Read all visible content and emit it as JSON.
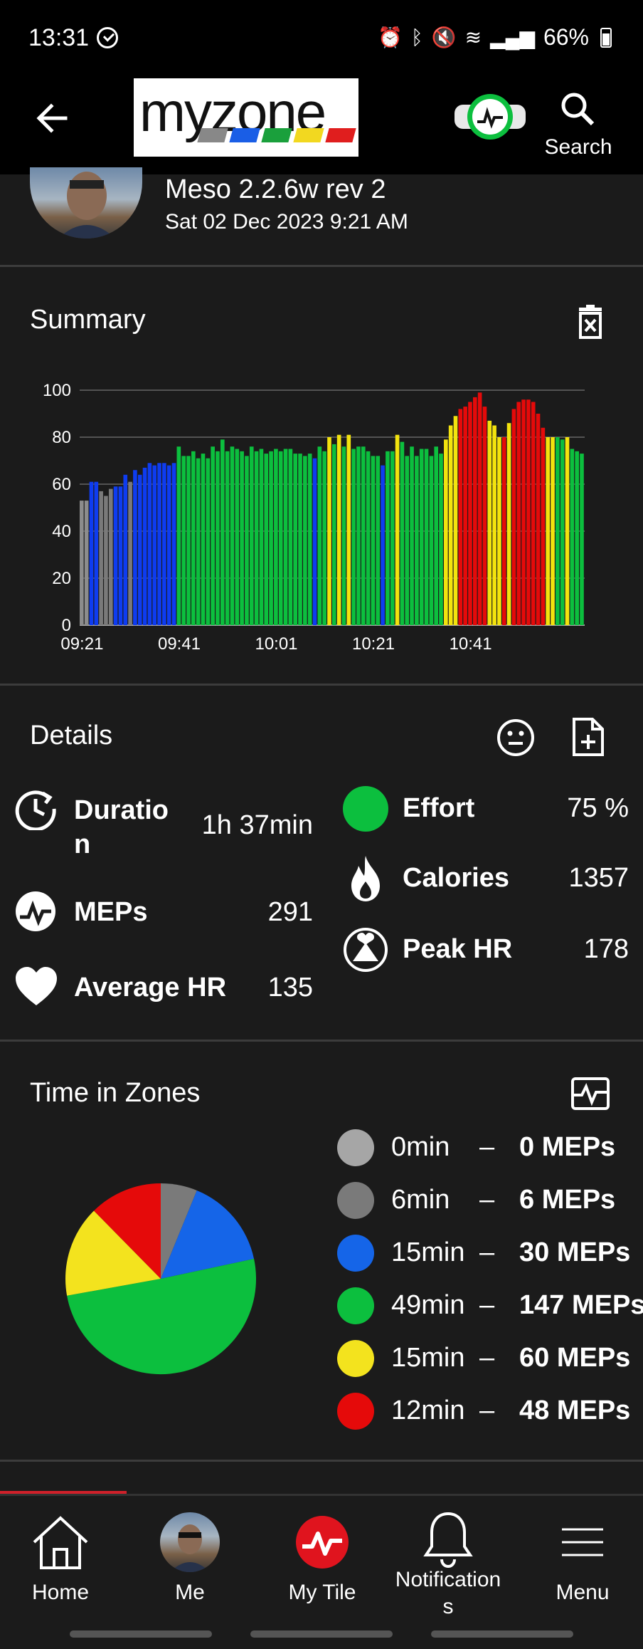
{
  "status_bar": {
    "time": "13:31",
    "battery": "66%"
  },
  "app_bar": {
    "logo_text": "myzone",
    "search_label": "Search"
  },
  "workout": {
    "title": "Meso 2.2.6w rev 2",
    "date": "Sat 02 Dec 2023 9:21 AM"
  },
  "summary": {
    "title": "Summary"
  },
  "chart_data": {
    "type": "bar",
    "title": "",
    "xlabel": "",
    "ylabel": "",
    "ylim": [
      0,
      100
    ],
    "y_ticks": [
      "0",
      "20",
      "40",
      "60",
      "80",
      "100"
    ],
    "x_ticks": [
      "09:21",
      "09:41",
      "10:01",
      "10:21",
      "10:41"
    ],
    "grid": true,
    "zone_colors": {
      "grey-light": "#8c8c8c",
      "grey": "#7a7a7a",
      "blue": "#0e3cf0",
      "green": "#0cbf3e",
      "yellow": "#f3e30e",
      "red": "#e50a0a"
    },
    "values": [
      53,
      53,
      61,
      61,
      57,
      55,
      58,
      59,
      59,
      64,
      61,
      66,
      64,
      67,
      69,
      68,
      69,
      69,
      68,
      69,
      76,
      72,
      72,
      74,
      71,
      73,
      71,
      76,
      74,
      79,
      74,
      76,
      75,
      74,
      72,
      76,
      74,
      75,
      73,
      74,
      75,
      74,
      75,
      75,
      73,
      73,
      72,
      73,
      71,
      76,
      74,
      80,
      77,
      81,
      76,
      81,
      75,
      76,
      76,
      74,
      72,
      72,
      68,
      74,
      74,
      81,
      78,
      72,
      76,
      72,
      75,
      75,
      72,
      76,
      73,
      79,
      85,
      89,
      92,
      93,
      95,
      97,
      99,
      93,
      87,
      85,
      80,
      80,
      86,
      92,
      95,
      96,
      96,
      95,
      90,
      84,
      80,
      80,
      80,
      79,
      80,
      75,
      74,
      73
    ],
    "zones": [
      "grey-light",
      "grey-light",
      "blue",
      "blue",
      "grey",
      "grey",
      "grey",
      "blue",
      "blue",
      "blue",
      "grey",
      "blue",
      "blue",
      "blue",
      "blue",
      "blue",
      "blue",
      "blue",
      "blue",
      "blue",
      "green",
      "green",
      "green",
      "green",
      "green",
      "green",
      "green",
      "green",
      "green",
      "green",
      "green",
      "green",
      "green",
      "green",
      "green",
      "green",
      "green",
      "green",
      "green",
      "green",
      "green",
      "green",
      "green",
      "green",
      "green",
      "green",
      "green",
      "green",
      "blue",
      "green",
      "green",
      "yellow",
      "green",
      "yellow",
      "green",
      "yellow",
      "green",
      "green",
      "green",
      "green",
      "green",
      "green",
      "blue",
      "green",
      "green",
      "yellow",
      "green",
      "green",
      "green",
      "green",
      "green",
      "green",
      "green",
      "green",
      "green",
      "yellow",
      "yellow",
      "yellow",
      "red",
      "red",
      "red",
      "red",
      "red",
      "red",
      "yellow",
      "yellow",
      "yellow",
      "red",
      "yellow",
      "red",
      "red",
      "red",
      "red",
      "red",
      "red",
      "red",
      "yellow",
      "yellow",
      "green",
      "green",
      "yellow",
      "green",
      "green",
      "green"
    ]
  },
  "details": {
    "title": "Details",
    "duration_label": "Duratio\nn",
    "duration_value": "1h 37min",
    "meps_label": "MEPs",
    "meps_value": "291",
    "avg_hr_label": "Average HR",
    "avg_hr_value": "135",
    "effort_label": "Effort",
    "effort_value": "75 %",
    "calories_label": "Calories",
    "calories_value": "1357",
    "peak_hr_label": "Peak HR",
    "peak_hr_value": "178"
  },
  "zones": {
    "title": "Time in Zones",
    "items": [
      {
        "minutes": "0min",
        "dash": "–",
        "meps": "0 MEPs",
        "color": "#a6a6a6",
        "share": 0
      },
      {
        "minutes": "6min",
        "dash": "–",
        "meps": "6 MEPs",
        "color": "#7a7a7a",
        "share": 6
      },
      {
        "minutes": "15min",
        "dash": "–",
        "meps": "30 MEPs",
        "color": "#1565e8",
        "share": 15
      },
      {
        "minutes": "49min",
        "dash": "–",
        "meps": "147 MEPs",
        "color": "#0cbf3e",
        "share": 49
      },
      {
        "minutes": "15min",
        "dash": "–",
        "meps": "60 MEPs",
        "color": "#f3e31e",
        "share": 15
      },
      {
        "minutes": "12min",
        "dash": "–",
        "meps": "48 MEPs",
        "color": "#e50a0a",
        "share": 12
      }
    ]
  },
  "nav": {
    "home": "Home",
    "me": "Me",
    "my_tile": "My Tile",
    "notifications": "Notification\ns",
    "menu": "Menu"
  }
}
